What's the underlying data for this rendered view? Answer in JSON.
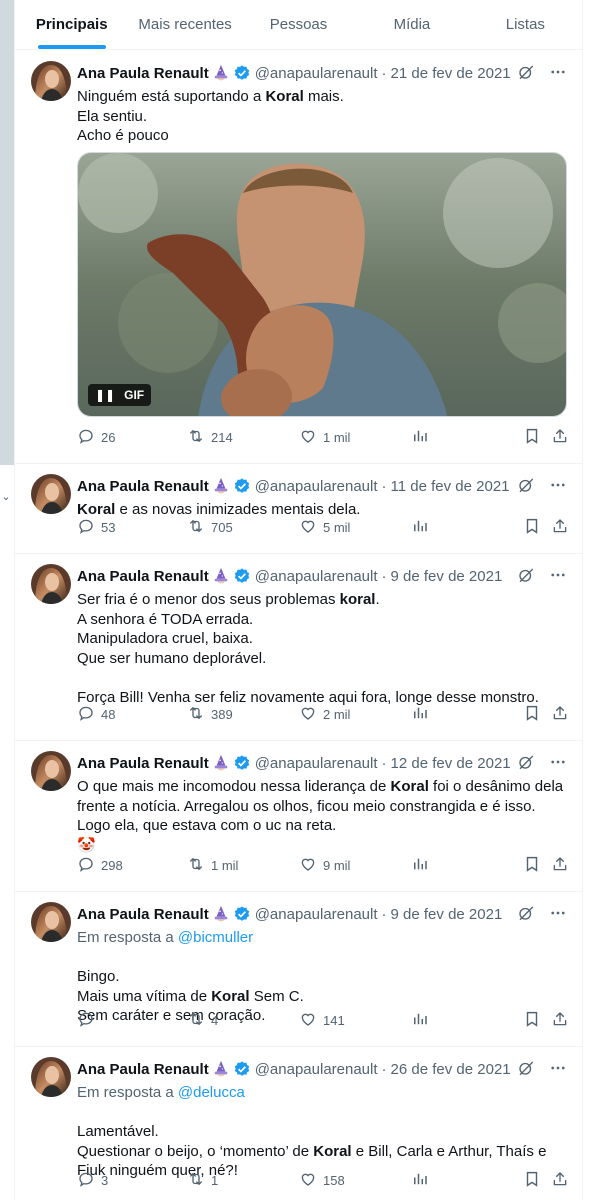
{
  "colors": {
    "accent": "#1d9bf0",
    "text": "#0f1419",
    "secondary": "#536471",
    "border": "#eff3f4"
  },
  "tabs": [
    {
      "label": "Principais",
      "active": true
    },
    {
      "label": "Mais recentes"
    },
    {
      "label": "Pessoas"
    },
    {
      "label": "Mídia"
    },
    {
      "label": "Listas"
    }
  ],
  "media": {
    "gif_label": "GIF"
  },
  "tweets": [
    {
      "name": "Ana Paula Renault",
      "handle": "@anapaularenault",
      "date": "21 de fev de 2021",
      "text": [
        "Ninguém está suportando a <b>Koral</b> mais.",
        "Ela sentiu.",
        "Acho é pouco"
      ],
      "replies": "26",
      "retweets": "214",
      "likes": "1 mil"
    },
    {
      "name": "Ana Paula Renault",
      "handle": "@anapaularenault",
      "date": "11 de fev de 2021",
      "text": [
        "<b>Koral</b> e as novas inimizades mentais dela."
      ],
      "replies": "53",
      "retweets": "705",
      "likes": "5 mil"
    },
    {
      "name": "Ana Paula Renault",
      "handle": "@anapaularenault",
      "date": "9 de fev de 2021",
      "text": [
        "Ser fria é o menor dos seus problemas <b>koral</b>.",
        "A senhora é TODA errada.",
        "Manipuladora cruel, baixa.",
        "Que ser humano deplorável.",
        "",
        "Força Bill! Venha ser feliz novamente aqui fora, longe desse monstro."
      ],
      "replies": "48",
      "retweets": "389",
      "likes": "2 mil"
    },
    {
      "name": "Ana Paula Renault",
      "handle": "@anapaularenault",
      "date": "12 de fev de 2021",
      "text": [
        "O que mais me incomodou nessa liderança de <b>Koral</b> foi o desânimo dela frente a notícia. Arregalou os olhos, ficou meio constrangida e é isso. Logo ela, que estava com o uc na reta.",
        "🤡"
      ],
      "replies": "298",
      "retweets": "1 mil",
      "likes": "9 mil"
    },
    {
      "name": "Ana Paula Renault",
      "handle": "@anapaularenault",
      "date": "9 de fev de 2021",
      "reply_to": "@bicmuller",
      "text": [
        "Bingo.",
        "Mais uma vítima de <b>Koral</b> Sem C.",
        "Sem caráter e sem coração."
      ],
      "replies": "",
      "retweets": "4",
      "likes": "141"
    },
    {
      "name": "Ana Paula Renault",
      "handle": "@anapaularenault",
      "date": "26 de fev de 2021",
      "reply_to": "@delucca",
      "text": [
        "Lamentável.",
        "Questionar o beijo, o ‘momento’ de <b>Koral</b> e Bill, Carla e Arthur, Thaís e Fiuk ninguém quer, né?!"
      ],
      "replies": "3",
      "retweets": "1",
      "likes": "158"
    }
  ],
  "reply_prefix": "Em resposta a",
  "icons": [
    "grok-icon",
    "more-icon",
    "reply-icon",
    "retweet-icon",
    "like-icon",
    "views-icon",
    "bookmark-icon",
    "share-icon",
    "verified-icon",
    "mage-emoji-icon",
    "pause-icon",
    "chevron-down-icon"
  ]
}
